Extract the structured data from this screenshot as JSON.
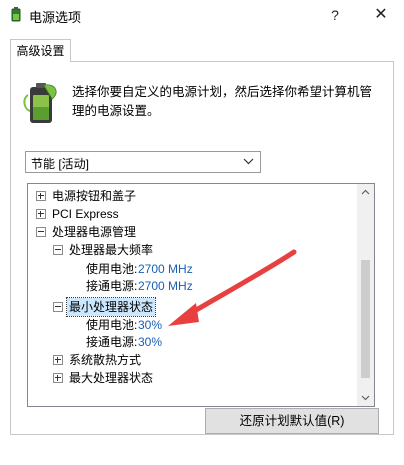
{
  "window": {
    "title": "电源选项",
    "help_glyph": "?",
    "close_glyph": "✕"
  },
  "tabs": [
    {
      "label": "高级设置"
    }
  ],
  "description": "选择你要自定义的电源计划，然后选择你希望计算机管理的电源设置。",
  "plan_select": {
    "value": "节能 [活动]"
  },
  "tree": {
    "items": [
      {
        "label": "电源按钮和盖子"
      },
      {
        "label": "PCI Express"
      },
      {
        "label": "处理器电源管理"
      },
      {
        "label": "处理器最大频率"
      },
      {
        "label": "使用电池:",
        "value": "2700 MHz"
      },
      {
        "label": "接通电源:",
        "value": "2700 MHz"
      },
      {
        "label": "最小处理器状态"
      },
      {
        "label": "使用电池:",
        "value": "30%"
      },
      {
        "label": "接通电源:",
        "value": "30%"
      },
      {
        "label": "系统散热方式"
      },
      {
        "label": "最大处理器状态"
      }
    ]
  },
  "buttons": {
    "restore": "还原计划默认值(R)"
  },
  "colors": {
    "annotation_arrow": "#e84040",
    "selection": "#cce8ff",
    "link_value": "#1a5fb4"
  },
  "icons": {
    "app": "power-options-icon",
    "battery": "battery-leaf-icon"
  }
}
